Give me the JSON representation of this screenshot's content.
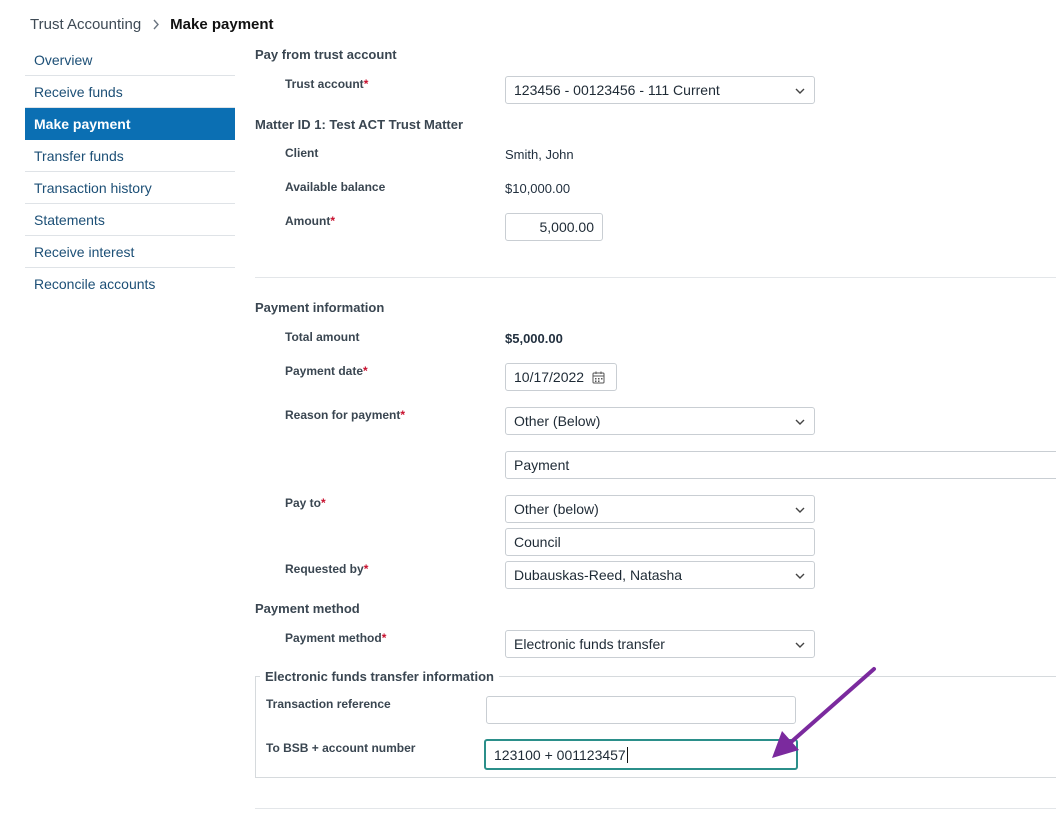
{
  "breadcrumb": {
    "root": "Trust Accounting",
    "current": "Make payment"
  },
  "sidebar": {
    "items": [
      {
        "label": "Overview"
      },
      {
        "label": "Receive funds"
      },
      {
        "label": "Make payment",
        "active": true
      },
      {
        "label": "Transfer funds"
      },
      {
        "label": "Transaction history"
      },
      {
        "label": "Statements"
      },
      {
        "label": "Receive interest"
      },
      {
        "label": "Reconcile accounts"
      }
    ]
  },
  "pay_from": {
    "title": "Pay from trust account",
    "trust_account_label": "Trust account",
    "trust_account_value": "123456 - 00123456 - 111 Current"
  },
  "matter": {
    "title": "Matter ID 1: Test ACT Trust Matter",
    "client_label": "Client",
    "client_value": "Smith, John",
    "balance_label": "Available balance",
    "balance_value": "$10,000.00",
    "amount_label": "Amount",
    "amount_value": "5,000.00"
  },
  "payment_info": {
    "title": "Payment information",
    "total_label": "Total amount",
    "total_value": "$5,000.00",
    "date_label": "Payment date",
    "date_value": "10/17/2022",
    "reason_label": "Reason for payment",
    "reason_value": "Other (Below)",
    "reason_text": "Payment",
    "pay_to_label": "Pay to",
    "pay_to_value": "Other (below)",
    "pay_to_text": "Council",
    "requested_label": "Requested by",
    "requested_value": "Dubauskas-Reed, Natasha"
  },
  "payment_method": {
    "title": "Payment method",
    "label": "Payment method",
    "value": "Electronic funds transfer"
  },
  "eft": {
    "legend": "Electronic funds transfer information",
    "reference_label": "Transaction reference",
    "reference_value": "",
    "bsb_label": "To BSB + account number",
    "bsb_value": "123100 + 001123457"
  },
  "required_mark": "*",
  "colors": {
    "accent": "#0b6fb3",
    "required": "#c8102e",
    "focus": "#2b8f8a",
    "annotation_arrow": "#7b2a9e"
  }
}
